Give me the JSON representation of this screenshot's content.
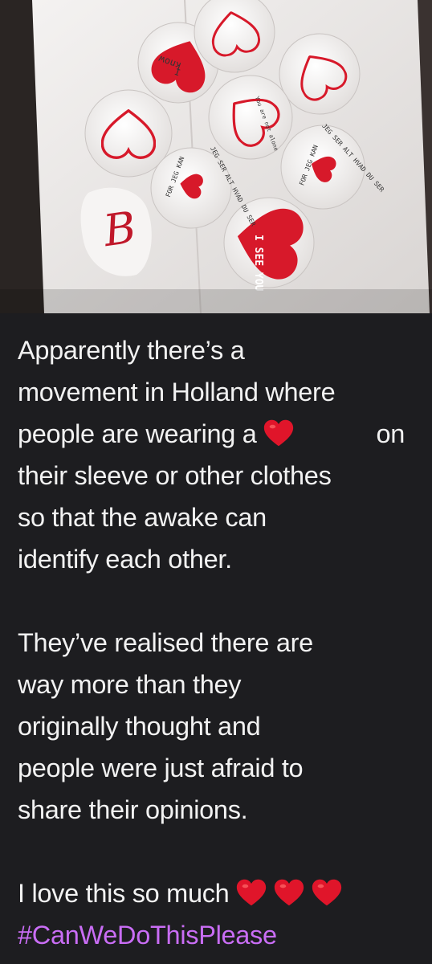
{
  "photo": {
    "badges": {
      "know_i": "know\nI",
      "i_see_you": "I SEE YOU",
      "jeg_ser": "JEG SER ALT HVAD DU SER",
      "for_jeg": "FOR JEG KAN",
      "you_are_not_alone": "You are not alone"
    },
    "colors": {
      "heart_red": "#d7192a",
      "badge_white": "#f3f0ef",
      "table": "#e9e6e4"
    }
  },
  "post": {
    "para1_line1": "Apparently there’s a",
    "para1_line2": "movement in Holland where",
    "para1_line3_a": "people are wearing a",
    "para1_line3_b": "on",
    "para1_line4": "their sleeve or other clothes",
    "para1_line5": "so that the awake can",
    "para1_line6": "identify each other.",
    "para2_line1": "They’ve realised there are",
    "para2_line2": "way more than they",
    "para2_line3": "originally thought and",
    "para2_line4": "people were just afraid to",
    "para2_line5": "share their opinions.",
    "para3_line1": "I love this so much",
    "hashtag": "#CanWeDoThisPlease",
    "colors": {
      "text": "#f2f2f2",
      "hashtag": "#c96df5",
      "heart_emoji": "#e0152a",
      "background": "#1d1d20"
    }
  }
}
